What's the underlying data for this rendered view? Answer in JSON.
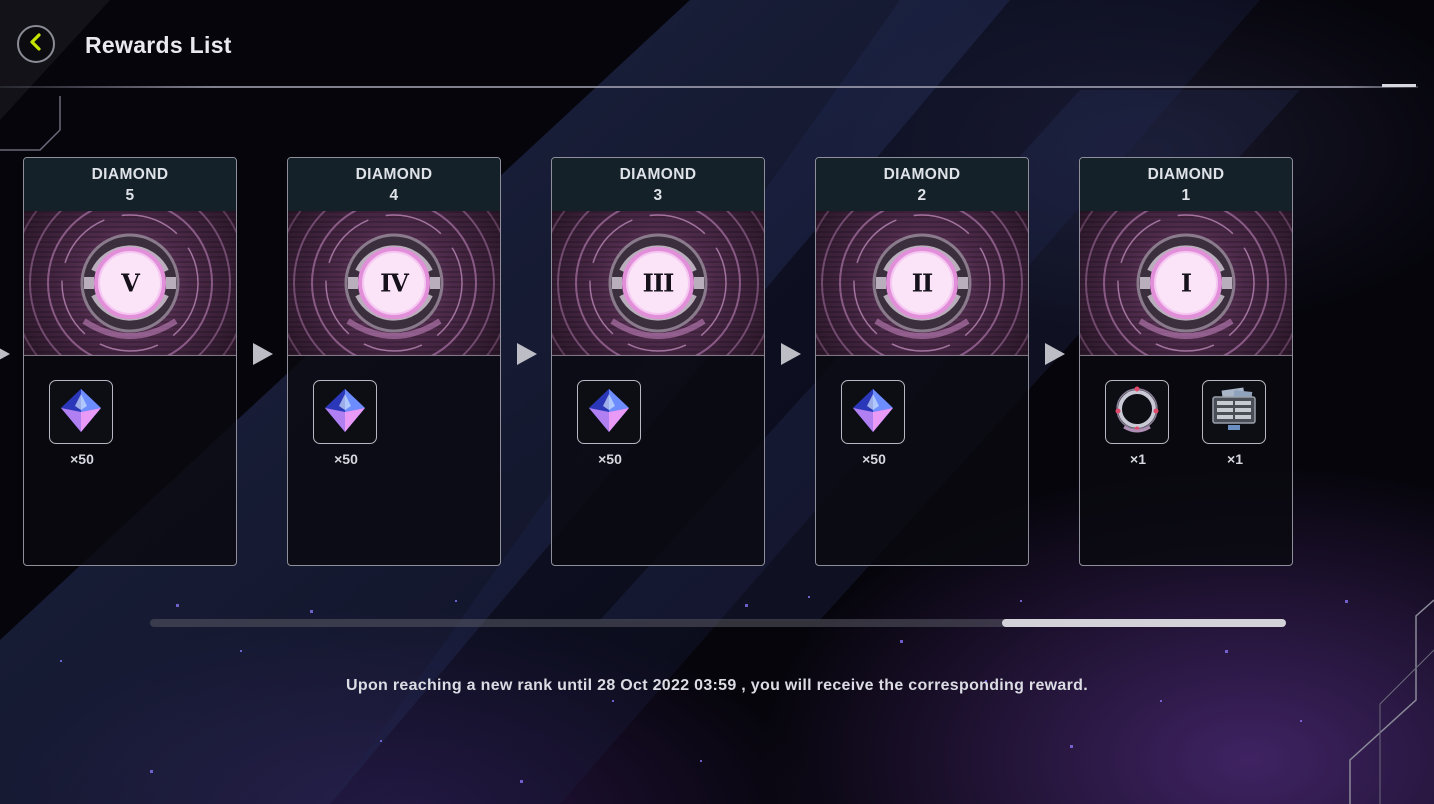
{
  "header": {
    "title": "Rewards List"
  },
  "cards": [
    {
      "rank_name": "DIAMOND",
      "rank_tier": "5",
      "numeral": "V",
      "rewards": [
        {
          "icon": "gem-icon",
          "quantity": "×50"
        }
      ]
    },
    {
      "rank_name": "DIAMOND",
      "rank_tier": "4",
      "numeral": "IV",
      "rewards": [
        {
          "icon": "gem-icon",
          "quantity": "×50"
        }
      ]
    },
    {
      "rank_name": "DIAMOND",
      "rank_tier": "3",
      "numeral": "III",
      "rewards": [
        {
          "icon": "gem-icon",
          "quantity": "×50"
        }
      ]
    },
    {
      "rank_name": "DIAMOND",
      "rank_tier": "2",
      "numeral": "II",
      "rewards": [
        {
          "icon": "gem-icon",
          "quantity": "×50"
        }
      ]
    },
    {
      "rank_name": "DIAMOND",
      "rank_tier": "1",
      "numeral": "I",
      "rewards": [
        {
          "icon": "icon-frame-icon",
          "quantity": "×1"
        },
        {
          "icon": "deck-case-icon",
          "quantity": "×1"
        }
      ]
    }
  ],
  "scrollbar": {
    "position_fraction": 0.75,
    "visible_fraction": 0.25
  },
  "footer": {
    "note": "Upon reaching a new rank until 28 Oct 2022 03:59 , you will receive the corresponding reward."
  },
  "colors": {
    "accent": "#c6e600",
    "emblem_pink": "#e8a6e3",
    "panel_header": "#142129"
  }
}
